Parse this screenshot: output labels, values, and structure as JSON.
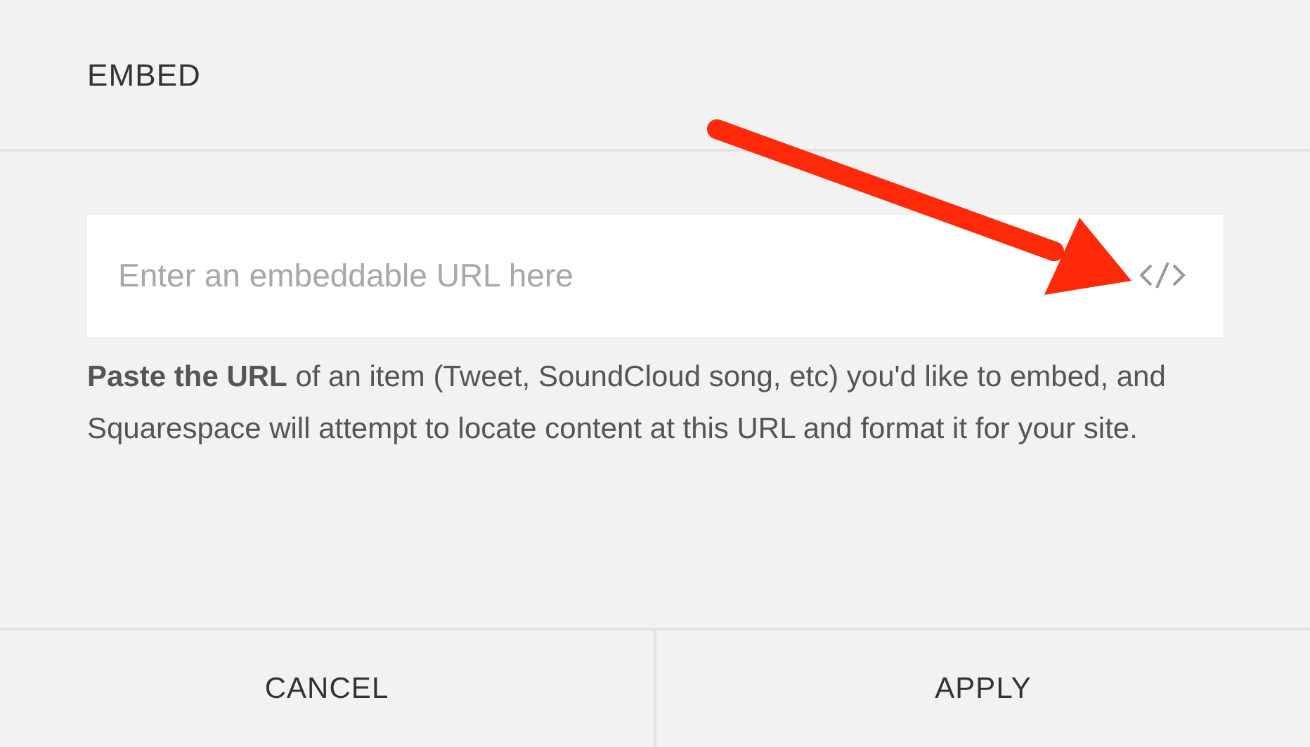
{
  "dialog": {
    "title": "EMBED"
  },
  "url_field": {
    "placeholder": "Enter an embeddable URL here"
  },
  "help_text": "**Paste the URL** of an item (Tweet, SoundCloud song, etc) you'd like to embed, and Squarespace will attempt to locate content at this URL and format it for your site.",
  "buttons": [
    {
      "label": "CANCEL"
    },
    {
      "label": "APPLY"
    }
  ]
}
